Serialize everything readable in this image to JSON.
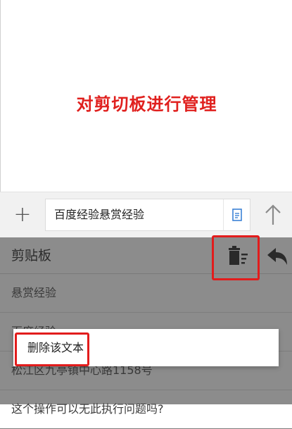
{
  "headline": "对剪切板进行管理",
  "input_bar": {
    "text_value": "百度经验悬赏经验"
  },
  "clipboard": {
    "title": "剪贴板",
    "items": [
      "悬赏经验",
      "百度经验",
      "松江区九亭镇中心路1158号",
      "这个操作可以无此执行问题吗?"
    ]
  },
  "popup": {
    "delete_label": "删除该文本"
  },
  "colors": {
    "headline": "#e0201e",
    "highlight": "#e21c1c",
    "panel": "#8c8c8c"
  }
}
